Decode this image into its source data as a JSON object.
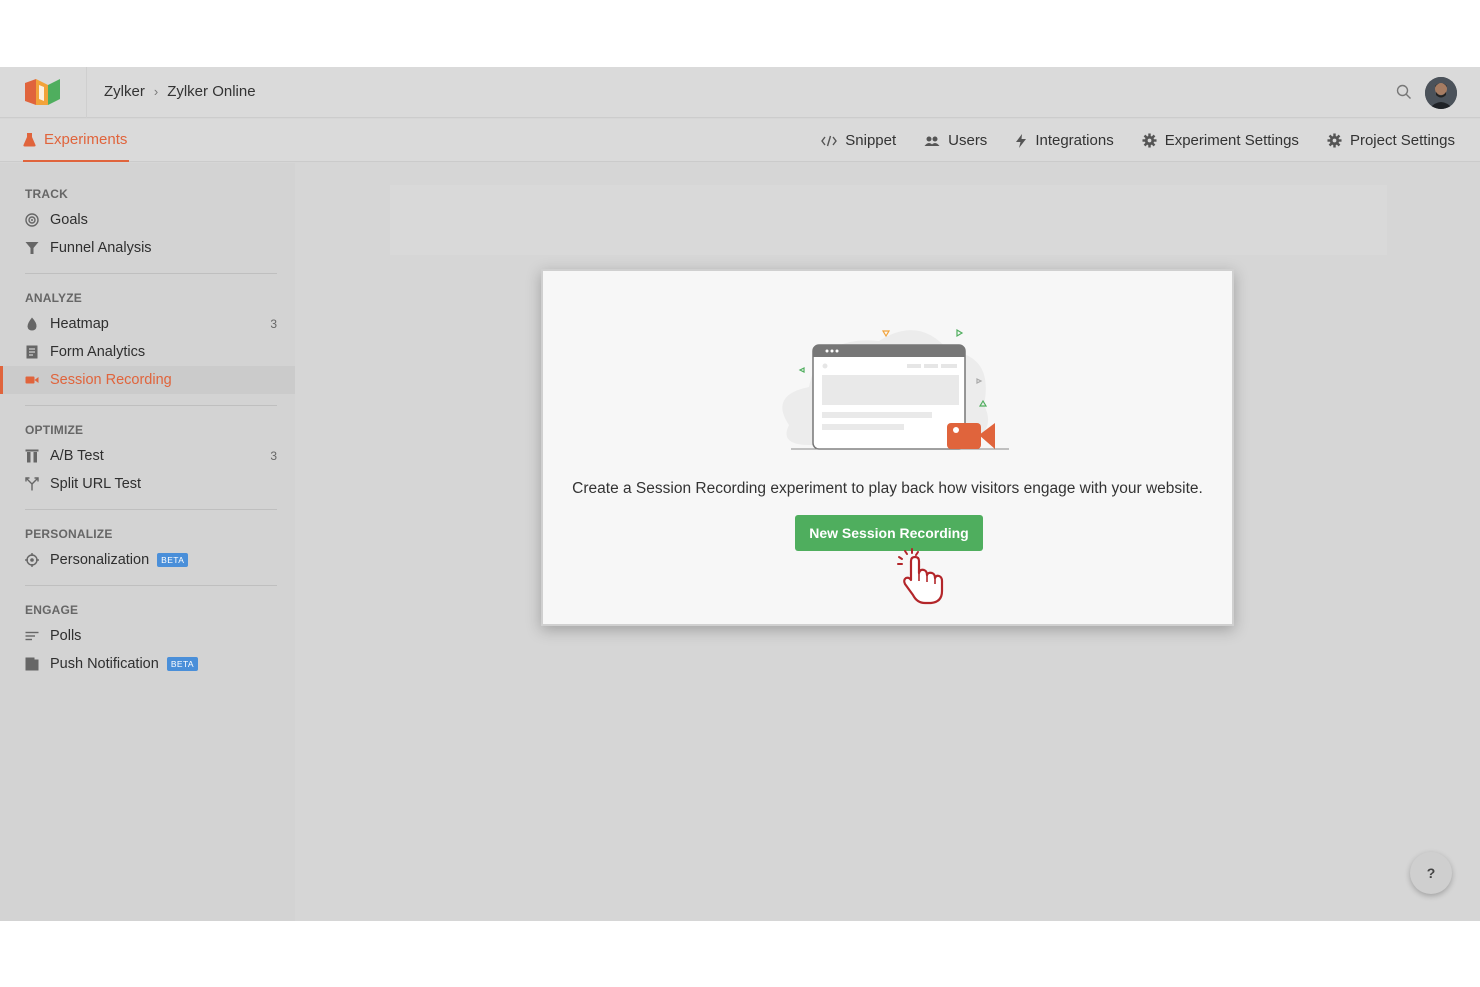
{
  "header": {
    "breadcrumb": [
      "Zylker",
      "Zylker Online"
    ],
    "breadcrumb_separator": "›"
  },
  "nav": {
    "primary": "Experiments",
    "items": [
      {
        "label": "Snippet",
        "icon": "code-icon"
      },
      {
        "label": "Users",
        "icon": "users-icon"
      },
      {
        "label": "Integrations",
        "icon": "bolt-icon"
      },
      {
        "label": "Experiment Settings",
        "icon": "gear-icon"
      },
      {
        "label": "Project Settings",
        "icon": "gear-icon"
      }
    ]
  },
  "sidebar": {
    "sections": [
      {
        "heading": "TRACK",
        "items": [
          {
            "label": "Goals",
            "icon": "target-icon"
          },
          {
            "label": "Funnel Analysis",
            "icon": "funnel-icon"
          }
        ]
      },
      {
        "heading": "ANALYZE",
        "items": [
          {
            "label": "Heatmap",
            "icon": "flame-icon",
            "count": "3"
          },
          {
            "label": "Form Analytics",
            "icon": "form-icon"
          },
          {
            "label": "Session Recording",
            "icon": "video-icon",
            "active": true
          }
        ]
      },
      {
        "heading": "OPTIMIZE",
        "items": [
          {
            "label": "A/B Test",
            "icon": "ab-test-icon",
            "count": "3"
          },
          {
            "label": "Split URL Test",
            "icon": "split-icon"
          }
        ]
      },
      {
        "heading": "PERSONALIZE",
        "items": [
          {
            "label": "Personalization",
            "icon": "crosshair-icon",
            "badge": "BETA"
          }
        ]
      },
      {
        "heading": "ENGAGE",
        "items": [
          {
            "label": "Polls",
            "icon": "list-icon"
          },
          {
            "label": "Push Notification",
            "icon": "bell-box-icon",
            "badge": "BETA"
          }
        ]
      }
    ]
  },
  "modal": {
    "message": "Create a Session Recording experiment to play back how visitors engage with your website.",
    "cta_label": "New Session Recording"
  },
  "help": {
    "label": "?"
  },
  "colors": {
    "accent": "#e0643c",
    "cta": "#4fae5e",
    "beta": "#4a8fd9"
  }
}
